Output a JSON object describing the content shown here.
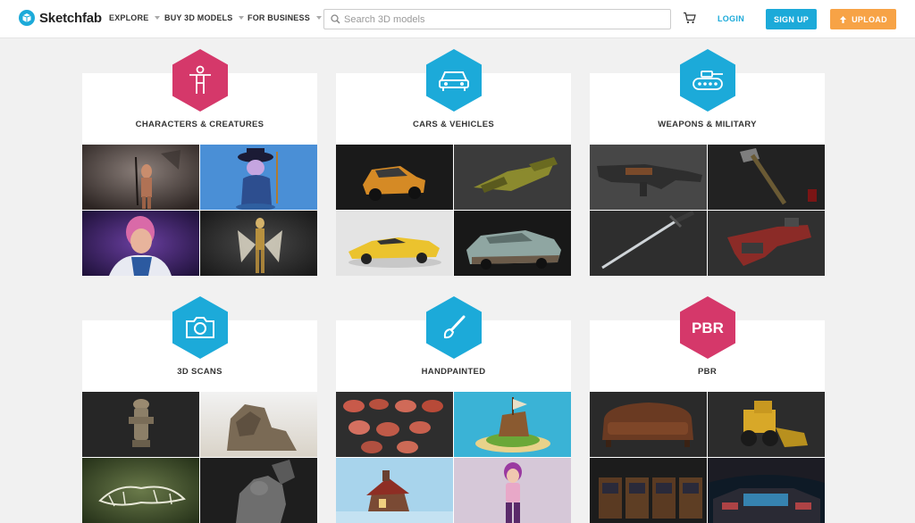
{
  "header": {
    "logo_text": "Sketchfab",
    "nav": {
      "explore": "EXPLORE",
      "buy": "BUY 3D MODELS",
      "business": "FOR BUSINESS"
    },
    "search": {
      "placeholder": "Search 3D models",
      "value": ""
    },
    "login": "LOGIN",
    "signup": "SIGN UP",
    "upload": "UPLOAD"
  },
  "categories": [
    {
      "title": "CHARACTERS & CREATURES",
      "icon": "person-icon",
      "color": "#d5386a"
    },
    {
      "title": "CARS & VEHICLES",
      "icon": "car-icon",
      "color": "#1caad9"
    },
    {
      "title": "WEAPONS & MILITARY",
      "icon": "tank-icon",
      "color": "#1caad9"
    },
    {
      "title": "3D SCANS",
      "icon": "camera-icon",
      "color": "#1caad9"
    },
    {
      "title": "HANDPAINTED",
      "icon": "paintbrush-icon",
      "color": "#1caad9"
    },
    {
      "title": "PBR",
      "icon": "pbr-icon",
      "color": "#d5386a",
      "badge": "PBR"
    }
  ],
  "colors": {
    "accent": "#1caad9",
    "upload": "#f7a346",
    "pink": "#d5386a",
    "background": "#f1f1f1"
  }
}
